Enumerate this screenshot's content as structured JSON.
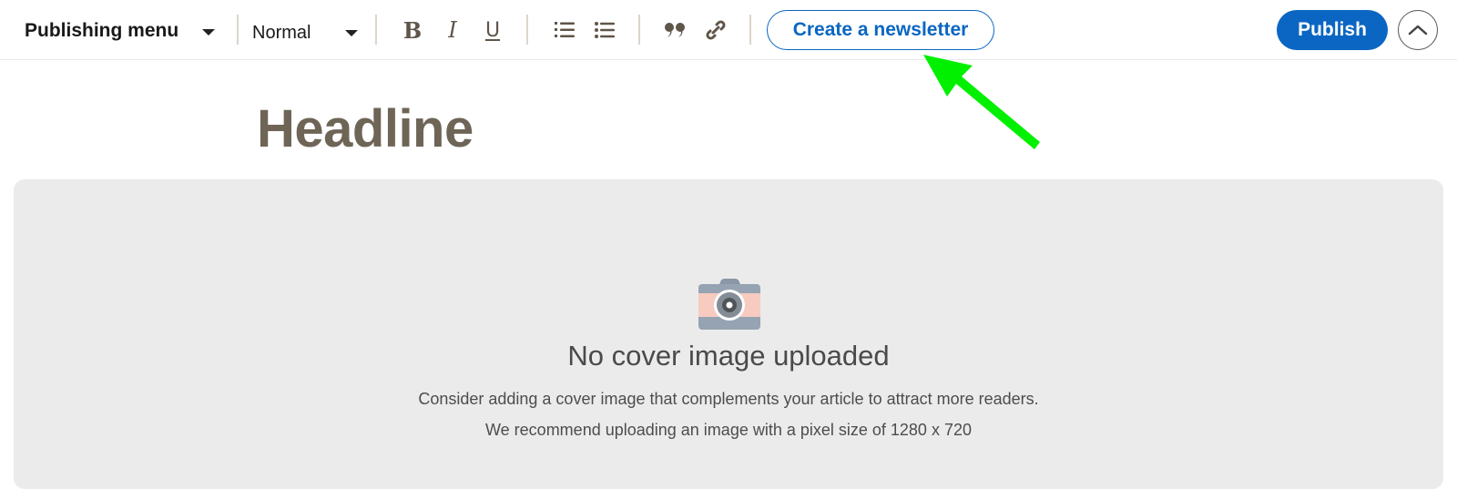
{
  "toolbar": {
    "publishing_menu_label": "Publishing menu",
    "text_style_selected": "Normal",
    "format_buttons": {
      "bold": "B",
      "italic": "I",
      "underline": "U"
    },
    "newsletter_button_label": "Create a newsletter",
    "publish_button_label": "Publish"
  },
  "annotation": {
    "arrow_color": "#00f000",
    "points_to": "Create a newsletter"
  },
  "editor": {
    "headline_placeholder": "Headline"
  },
  "cover": {
    "title": "No cover image uploaded",
    "line1": "Consider adding a cover image that complements your article to attract more readers.",
    "line2": "We recommend uploading an image with a pixel size of 1280 x 720"
  },
  "colors": {
    "brand_blue": "#0a66c2",
    "headline_text": "#6e6557",
    "icon_brown": "#5f5549",
    "cover_bg": "#ebebeb"
  }
}
